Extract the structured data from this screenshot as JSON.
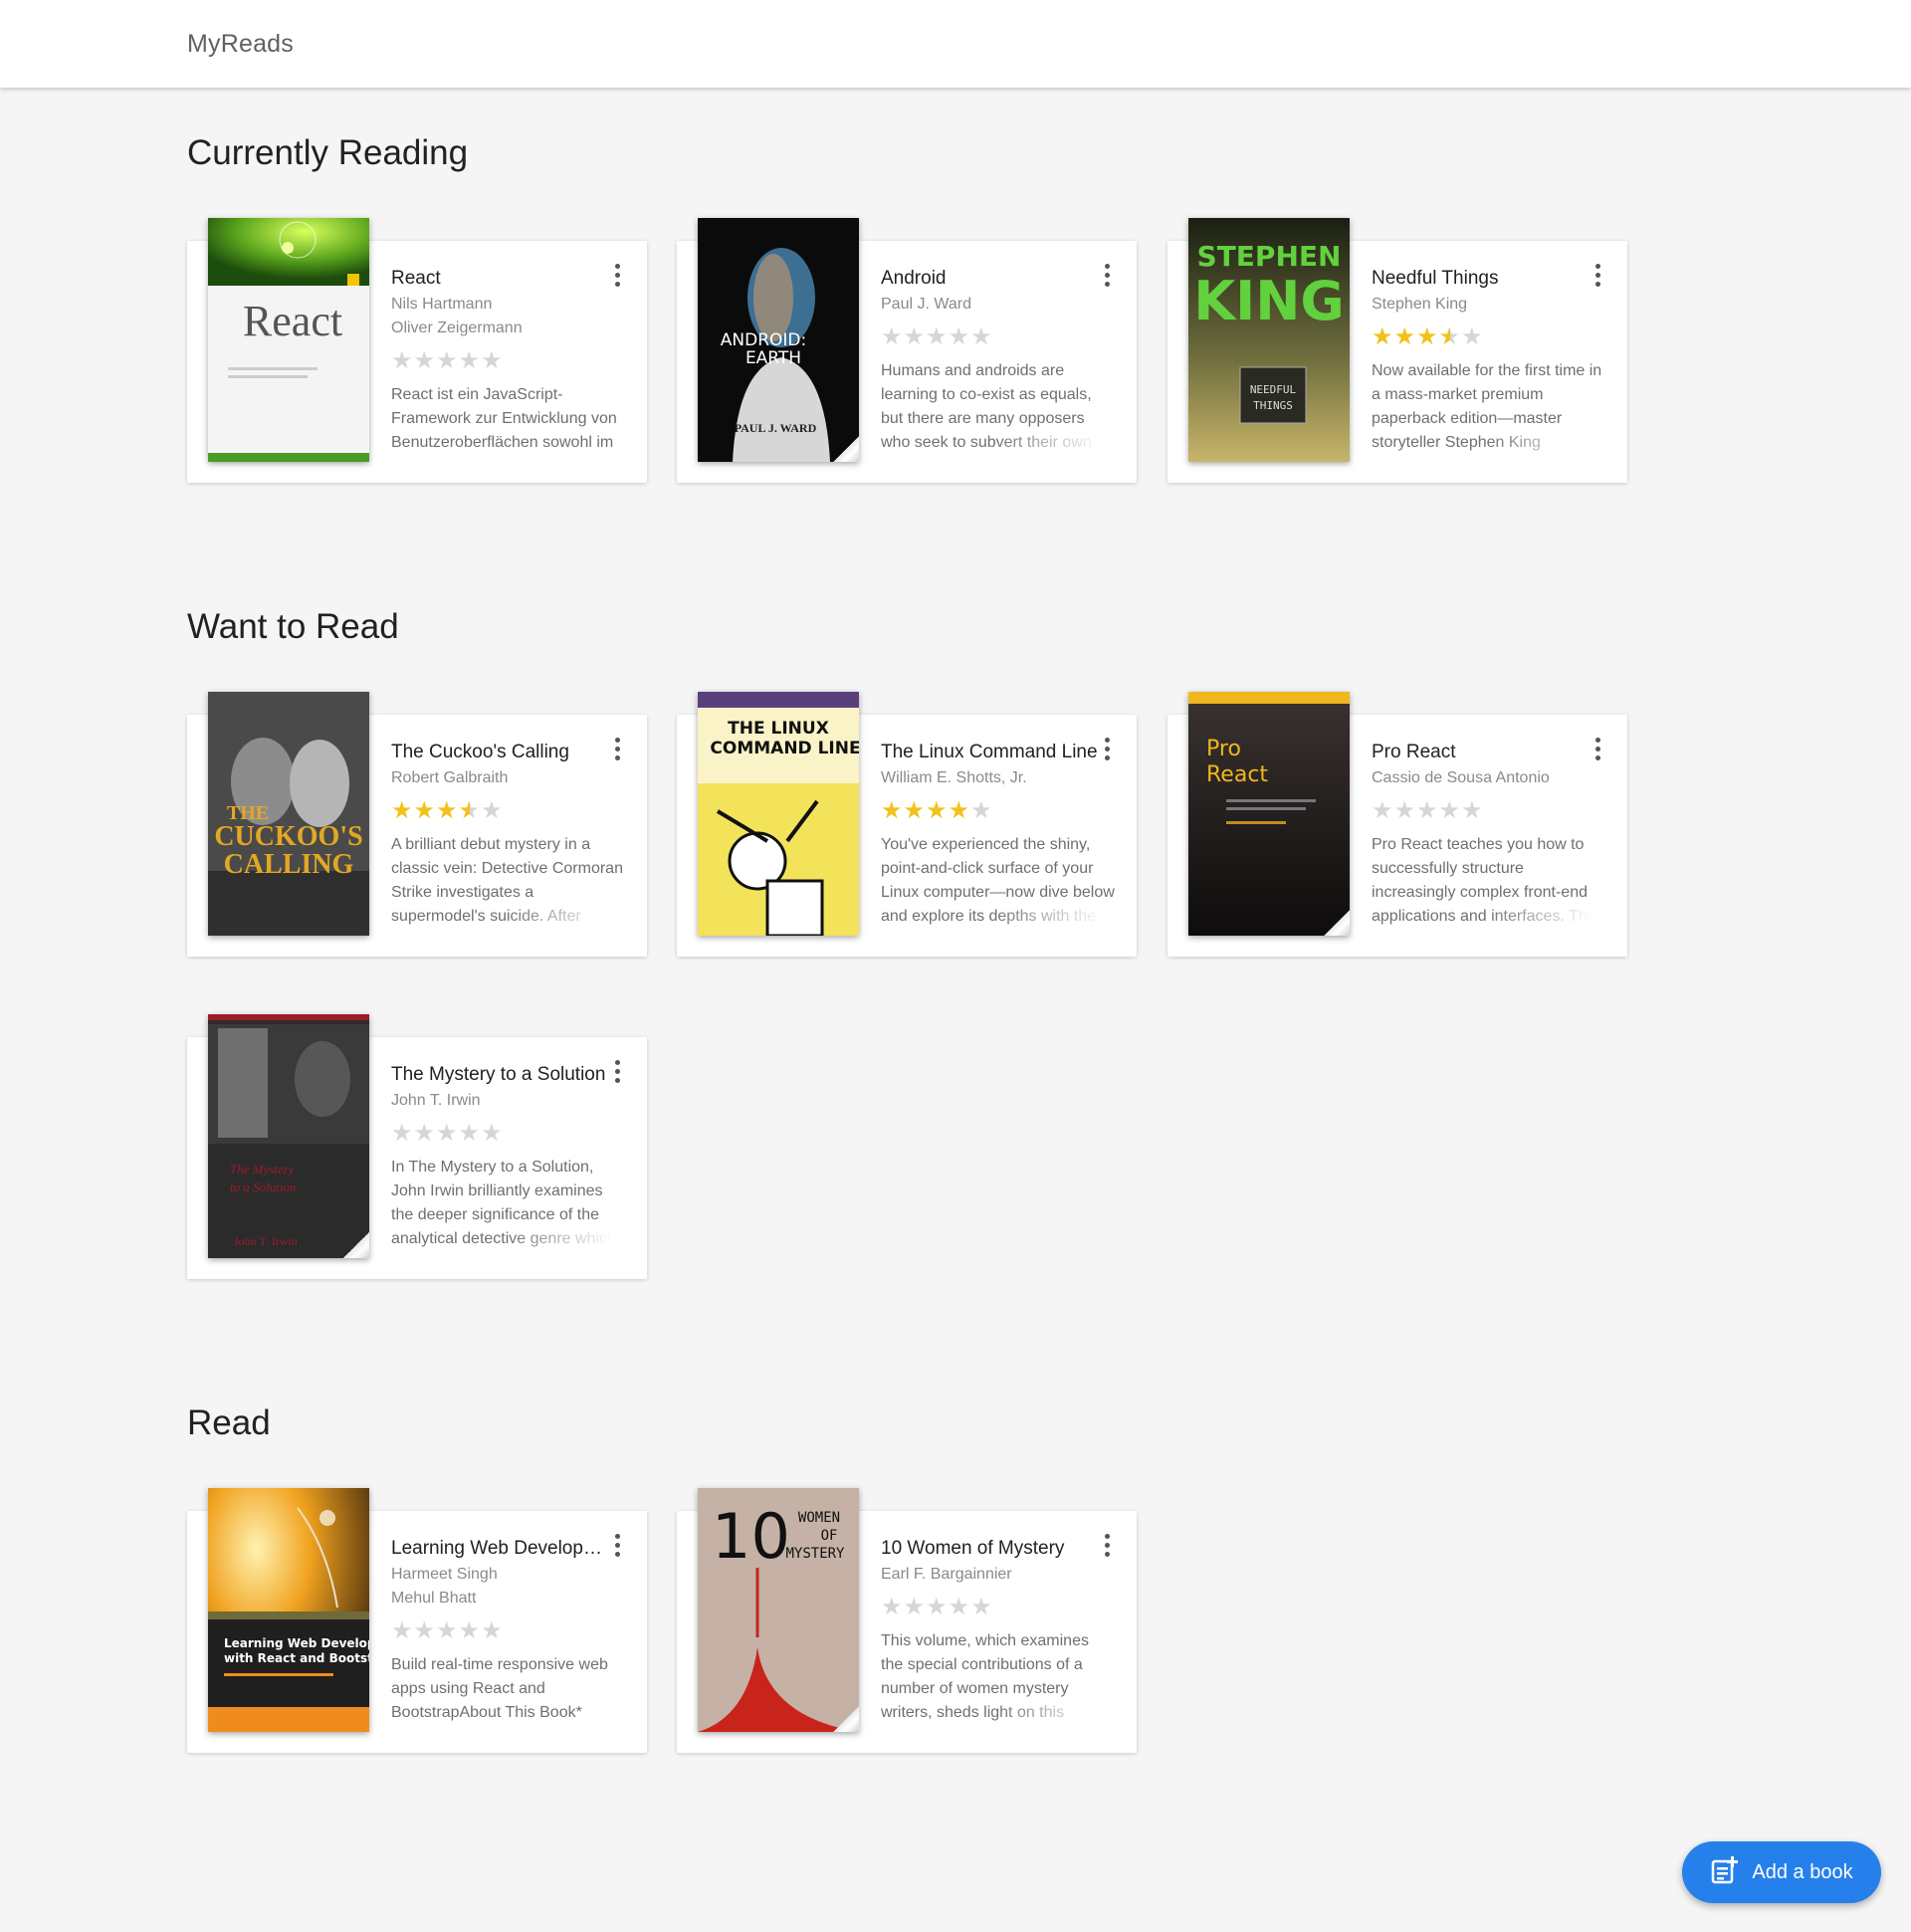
{
  "app": {
    "title": "MyReads"
  },
  "shelves": [
    {
      "title": "Currently Reading",
      "books": [
        {
          "title": "React",
          "authors": [
            "Nils Hartmann",
            "Oliver Zeigermann"
          ],
          "rating": 0,
          "description": "React ist ein JavaScript-Framework zur Entwicklung von Benutzeroberflächen sowohl im",
          "cover_text": [
            "React"
          ]
        },
        {
          "title": "Android",
          "authors": [
            "Paul J. Ward"
          ],
          "rating": 0,
          "description": "Humans and androids are learning to co-exist as equals, but there are many opposers who seek to subvert their own",
          "cover_text": [
            "ANDROID:",
            "EARTH",
            "PAUL J. WARD"
          ]
        },
        {
          "title": "Needful Things",
          "authors": [
            "Stephen King"
          ],
          "rating": 3.5,
          "description": "Now available for the first time in a mass-market premium paperback edition—master storyteller Stephen King presents",
          "cover_text": [
            "STEPHEN",
            "KING",
            "NEEDFUL",
            "THINGS"
          ]
        }
      ]
    },
    {
      "title": "Want to Read",
      "books": [
        {
          "title": "The Cuckoo's Calling",
          "authors": [
            "Robert Galbraith"
          ],
          "rating": 3.5,
          "description": "A brilliant debut mystery in a classic vein: Detective Cormoran Strike investigates a supermodel's suicide. After",
          "cover_text": [
            "THE",
            "CUCKOO'S",
            "CALLING"
          ]
        },
        {
          "title": "The Linux Command Line",
          "authors": [
            "William E. Shotts, Jr."
          ],
          "rating": 4,
          "description": "You've experienced the shiny, point-and-click surface of your Linux computer—now dive below and explore its depths with the",
          "cover_text": [
            "THE LINUX",
            "COMMAND LINE"
          ]
        },
        {
          "title": "Pro React",
          "authors": [
            "Cassio de Sousa Antonio"
          ],
          "rating": 0,
          "description": "Pro React teaches you how to successfully structure increasingly complex front-end applications and interfaces. This",
          "cover_text": [
            "Pro",
            "React"
          ]
        },
        {
          "title": "The Mystery to a Solution",
          "authors": [
            "John T. Irwin"
          ],
          "rating": 0,
          "description": "In The Mystery to a Solution, John Irwin brilliantly examines the deeper significance of the analytical detective genre which",
          "cover_text": [
            "The Mystery",
            "to a Solution",
            "John T. Irwin"
          ]
        }
      ]
    },
    {
      "title": "Read",
      "books": [
        {
          "title": "Learning Web Development with React and Bootstrap",
          "authors": [
            "Harmeet Singh",
            "Mehul Bhatt"
          ],
          "rating": 0,
          "description": "Build real-time responsive web apps using React and BootstrapAbout This Book*",
          "cover_text": [
            "Learning Web Developm",
            "with React and Bootstra"
          ]
        },
        {
          "title": "10 Women of Mystery",
          "authors": [
            "Earl F. Bargainnier"
          ],
          "rating": 0,
          "description": "This volume, which examines the special contributions of a number of women mystery writers, sheds light on this",
          "cover_text": [
            "10",
            "WOMEN",
            "OF",
            "MYSTERY"
          ]
        }
      ]
    }
  ],
  "fab": {
    "label": "Add a book",
    "icon": "add-list-icon"
  },
  "colors": {
    "accent": "#2680eb",
    "star": "#f3c11b",
    "star_empty": "#d6d6d6"
  }
}
